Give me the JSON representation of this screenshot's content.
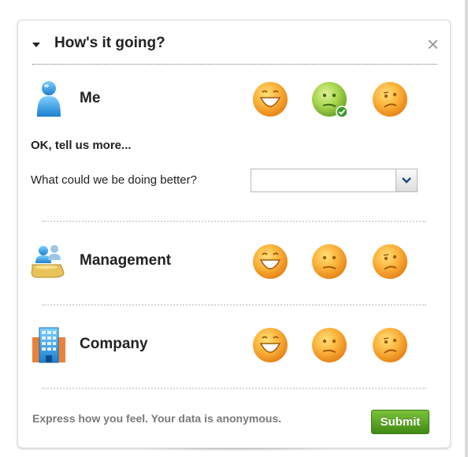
{
  "widget": {
    "title": "How's it going?",
    "close_label": "×",
    "collapse_icon": "caret-down-icon"
  },
  "sections": [
    {
      "label": "Me",
      "icon": "person-icon",
      "selected": "neutral",
      "ratings": [
        "happy",
        "neutral",
        "sad"
      ]
    },
    {
      "label": "Management",
      "icon": "management-icon",
      "selected": "",
      "ratings": [
        "happy",
        "neutral",
        "sad"
      ]
    },
    {
      "label": "Company",
      "icon": "building-icon",
      "selected": "",
      "ratings": [
        "happy",
        "neutral",
        "sad"
      ]
    }
  ],
  "followup": {
    "title": "OK, tell us more...",
    "question": "What could we be doing better?",
    "selected_value": ""
  },
  "footer": {
    "note": "Express how you feel. Your data is anonymous.",
    "submit_label": "Submit"
  },
  "colors": {
    "face_orange": "#f29a1f",
    "face_selected_green": "#8cc63f",
    "submit_green": "#4f9a1c"
  }
}
